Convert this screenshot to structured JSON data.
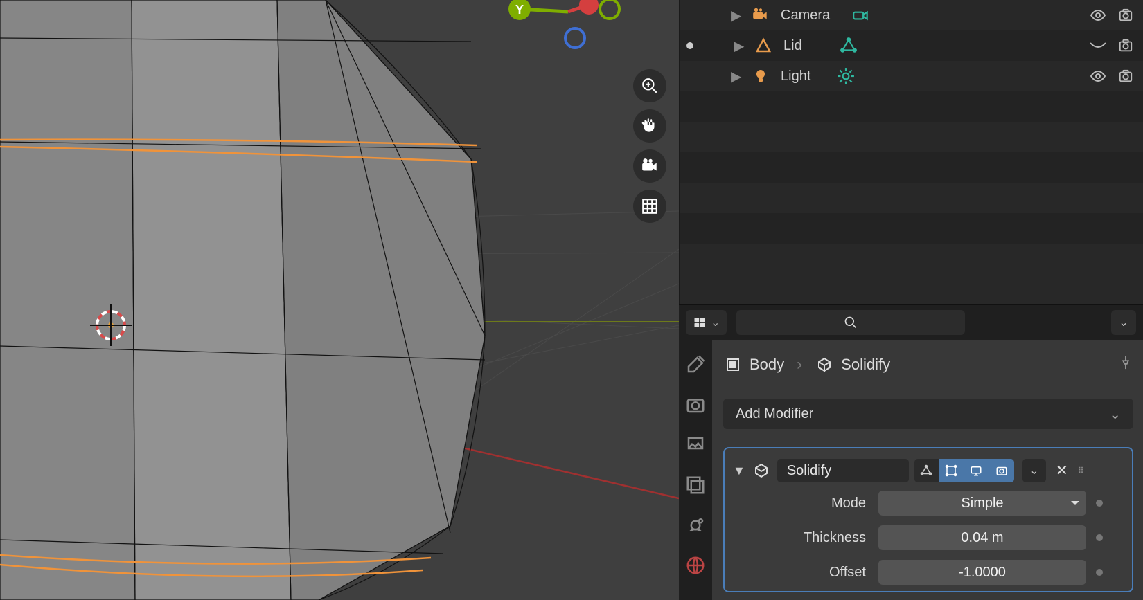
{
  "outliner": {
    "items": [
      {
        "name": "Camera",
        "icon": "camera",
        "icon_color": "#e89b4c",
        "data_icon": "camera-data",
        "data_color": "#2fb8a0",
        "eye": true
      },
      {
        "name": "Lid",
        "icon": "mesh",
        "icon_color": "#e89b4c",
        "data_icon": "mesh-data",
        "data_color": "#2fb8a0",
        "eye": false
      },
      {
        "name": "Light",
        "icon": "light",
        "icon_color": "#e89b4c",
        "data_icon": "light-data",
        "data_color": "#2fb8a0",
        "eye": true
      }
    ]
  },
  "breadcrumb": {
    "object": "Body",
    "modifier": "Solidify"
  },
  "add_modifier_label": "Add Modifier",
  "modifier": {
    "name": "Solidify",
    "toggles": {
      "edit": false,
      "cage": true,
      "viewport": true,
      "render": true
    },
    "props": {
      "mode_label": "Mode",
      "mode_value": "Simple",
      "thickness_label": "Thickness",
      "thickness_value": "0.04 m",
      "offset_label": "Offset",
      "offset_value": "-1.0000"
    }
  },
  "gizmo": {
    "y_label": "Y"
  }
}
